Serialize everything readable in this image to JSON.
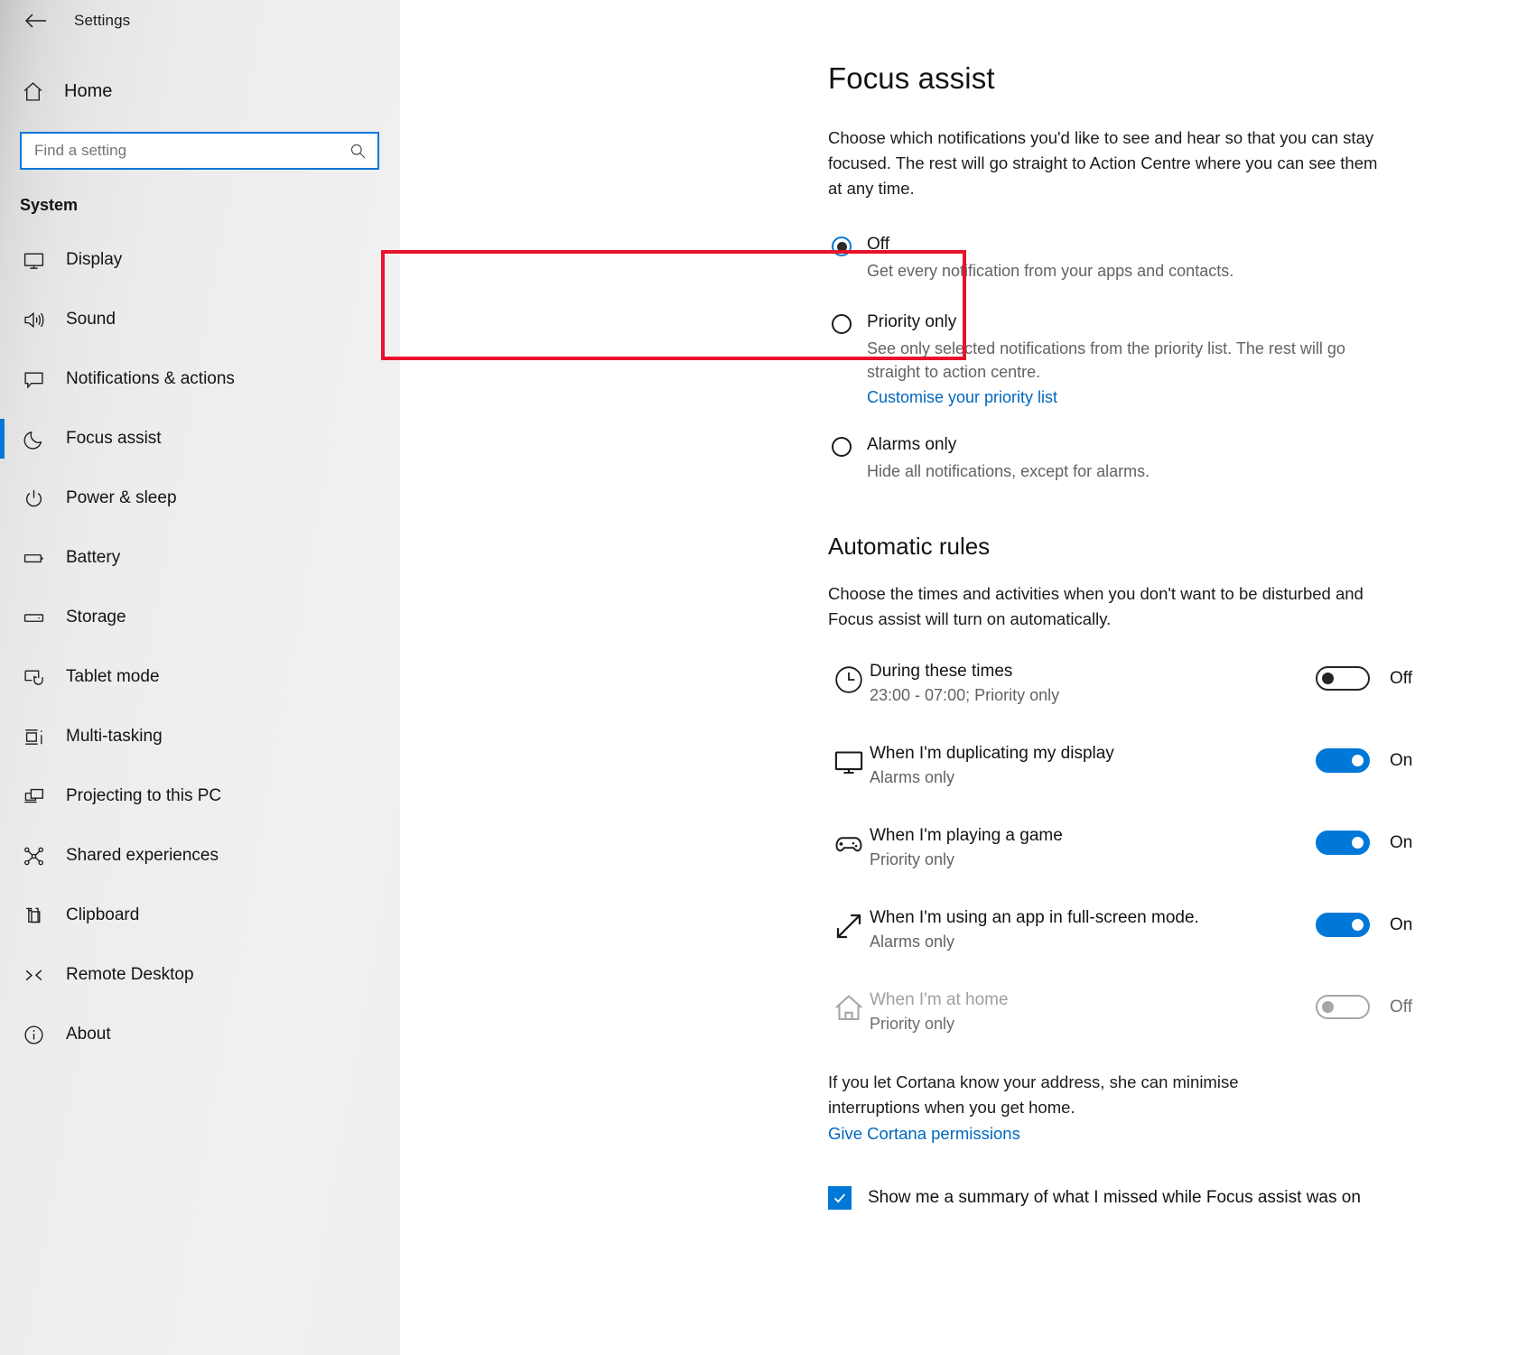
{
  "window": {
    "back_label": "Back",
    "title": "Settings"
  },
  "sidebar": {
    "home": {
      "label": "Home",
      "icon": "home-icon"
    },
    "search": {
      "value": "",
      "placeholder": "Find a setting",
      "icon": "search-icon"
    },
    "group_title": "System",
    "items": [
      {
        "label": "Display",
        "icon": "monitor-icon",
        "selected": false
      },
      {
        "label": "Sound",
        "icon": "speaker-icon",
        "selected": false
      },
      {
        "label": "Notifications & actions",
        "icon": "speech-bubble-icon",
        "selected": false
      },
      {
        "label": "Focus assist",
        "icon": "moon-icon",
        "selected": true
      },
      {
        "label": "Power & sleep",
        "icon": "power-icon",
        "selected": false
      },
      {
        "label": "Battery",
        "icon": "battery-icon",
        "selected": false
      },
      {
        "label": "Storage",
        "icon": "storage-icon",
        "selected": false
      },
      {
        "label": "Tablet mode",
        "icon": "tablet-icon",
        "selected": false
      },
      {
        "label": "Multi-tasking",
        "icon": "multitask-icon",
        "selected": false
      },
      {
        "label": "Projecting to this PC",
        "icon": "project-icon",
        "selected": false
      },
      {
        "label": "Shared experiences",
        "icon": "share-icon",
        "selected": false
      },
      {
        "label": "Clipboard",
        "icon": "clipboard-icon",
        "selected": false
      },
      {
        "label": "Remote Desktop",
        "icon": "remote-desktop-icon",
        "selected": false
      },
      {
        "label": "About",
        "icon": "info-icon",
        "selected": false
      }
    ]
  },
  "main": {
    "page_title": "Focus assist",
    "intro": "Choose which notifications you'd like to see and hear so that you can stay focused. The rest will go straight to Action Centre where you can see them at any time.",
    "modes": [
      {
        "label": "Off",
        "description": "Get every notification from your apps and contacts.",
        "checked": true,
        "link": null
      },
      {
        "label": "Priority only",
        "description": "See only selected notifications from the priority list. The rest will go straight to action centre.",
        "checked": false,
        "link": "Customise your priority list",
        "highlighted": true
      },
      {
        "label": "Alarms only",
        "description": "Hide all notifications, except for alarms.",
        "checked": false,
        "link": null
      }
    ],
    "automatic_rules": {
      "title": "Automatic rules",
      "description": "Choose the times and activities when you don't want to be disturbed and Focus assist will turn on automatically.",
      "rules": [
        {
          "title": "During these times",
          "sub": "23:00 - 07:00; Priority only",
          "icon": "clock-icon",
          "state": "Off",
          "on": false,
          "disabled": false
        },
        {
          "title": "When I'm duplicating my display",
          "sub": "Alarms only",
          "icon": "monitor-icon",
          "state": "On",
          "on": true,
          "disabled": false
        },
        {
          "title": "When I'm playing a game",
          "sub": "Priority only",
          "icon": "gamepad-icon",
          "state": "On",
          "on": true,
          "disabled": false
        },
        {
          "title": "When I'm using an app in full-screen mode.",
          "sub": "Alarms only",
          "icon": "fullscreen-arrows-icon",
          "state": "On",
          "on": true,
          "disabled": false
        },
        {
          "title": "When I'm at home",
          "sub": "Priority only",
          "icon": "home-icon",
          "state": "Off",
          "on": false,
          "disabled": true
        }
      ],
      "cortana_note": "If you let Cortana know your address, she can minimise interruptions when you get home.",
      "cortana_link": "Give Cortana permissions"
    },
    "summary_checkbox": {
      "label": "Show me a summary of what I missed while Focus assist was on",
      "checked": true
    }
  },
  "colors": {
    "accent": "#0078d7",
    "link": "#0067c0",
    "highlight_box": "#e8122b",
    "text": "#131313",
    "muted": "#636363"
  }
}
